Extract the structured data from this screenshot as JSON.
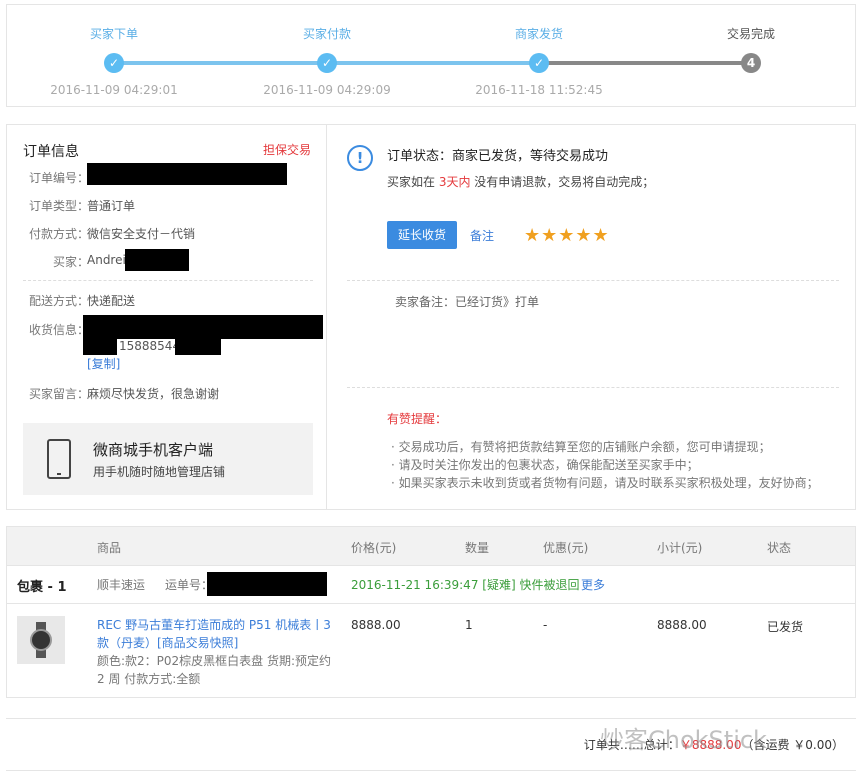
{
  "progress": {
    "steps": [
      {
        "label": "买家下单",
        "time": "2016-11-09 04:29:01",
        "mark": "✓"
      },
      {
        "label": "买家付款",
        "time": "2016-11-09 04:29:09",
        "mark": "✓"
      },
      {
        "label": "商家发货",
        "time": "2016-11-18 11:52:45",
        "mark": "✓"
      },
      {
        "label": "交易完成",
        "time": "",
        "mark": "4"
      }
    ]
  },
  "order_info": {
    "title": "订单信息",
    "tag": "担保交易",
    "order_no_label": "订单编号：",
    "type_label": "订单类型：",
    "type_value": "普通订单",
    "pay_label": "付款方式：",
    "pay_value": "微信安全支付－代销",
    "buyer_label": "买家：",
    "buyer_value": "Andrei",
    "delivery_label": "配送方式：",
    "delivery_value": "快递配送",
    "address_label": "收货信息：",
    "address_phone": "15888544",
    "copy_link": "[复制]",
    "message_label": "买家留言：",
    "message_value": "麻烦尽快发货，很急谢谢",
    "app_title": "微商城手机客户端",
    "app_sub": "用手机随时随地管理店铺"
  },
  "status": {
    "icon": "!",
    "title": "订单状态：商家已发货，等待交易成功",
    "sub_pre": "买家如在 ",
    "sub_days": "3天内",
    "sub_post": " 没有申请退款，交易将自动完成；",
    "extend_button": "延长收货",
    "note_link": "备注",
    "stars": "★★★★★",
    "star_rating": 5,
    "seller_note": "卖家备注：已经订货》打单",
    "tips_title": "有赞提醒：",
    "tips": [
      "· 交易成功后，有赞将把货款结算至您的店铺账户余额，您可申请提现；",
      "· 请及时关注你发出的包裹状态，确保能配送至买家手中；",
      "· 如果买家表示未收到货或者货物有问题，请及时联系买家积极处理，友好协商；"
    ]
  },
  "table": {
    "headers": [
      "商品",
      "价格(元)",
      "数量",
      "优惠(元)",
      "小计(元)",
      "状态"
    ],
    "package_label": "包裹 - 1",
    "carrier": "顺丰速运",
    "tracking_label": "运单号：",
    "tracking_status": "2016-11-21 16:39:47 [疑难] 快件被退回",
    "more_link": "更多",
    "item": {
      "name": "REC 野马古董车打造而成的 P51 机械表丨3款（丹麦）[商品交易快照]",
      "attrs": "颜色:款2：P02棕皮黑框白表盘 货期:预定约2 周 付款方式:全额",
      "price": "8888.00",
      "qty": "1",
      "discount": "-",
      "subtotal": "8888.00",
      "status": "已发货"
    }
  },
  "footer": {
    "total_pre": "订单共",
    "total_mid": "总计：",
    "total_amount": "￥8888.00",
    "total_post": "（含运费 ￥0.00）",
    "watermark": "炒客ChokStick"
  }
}
